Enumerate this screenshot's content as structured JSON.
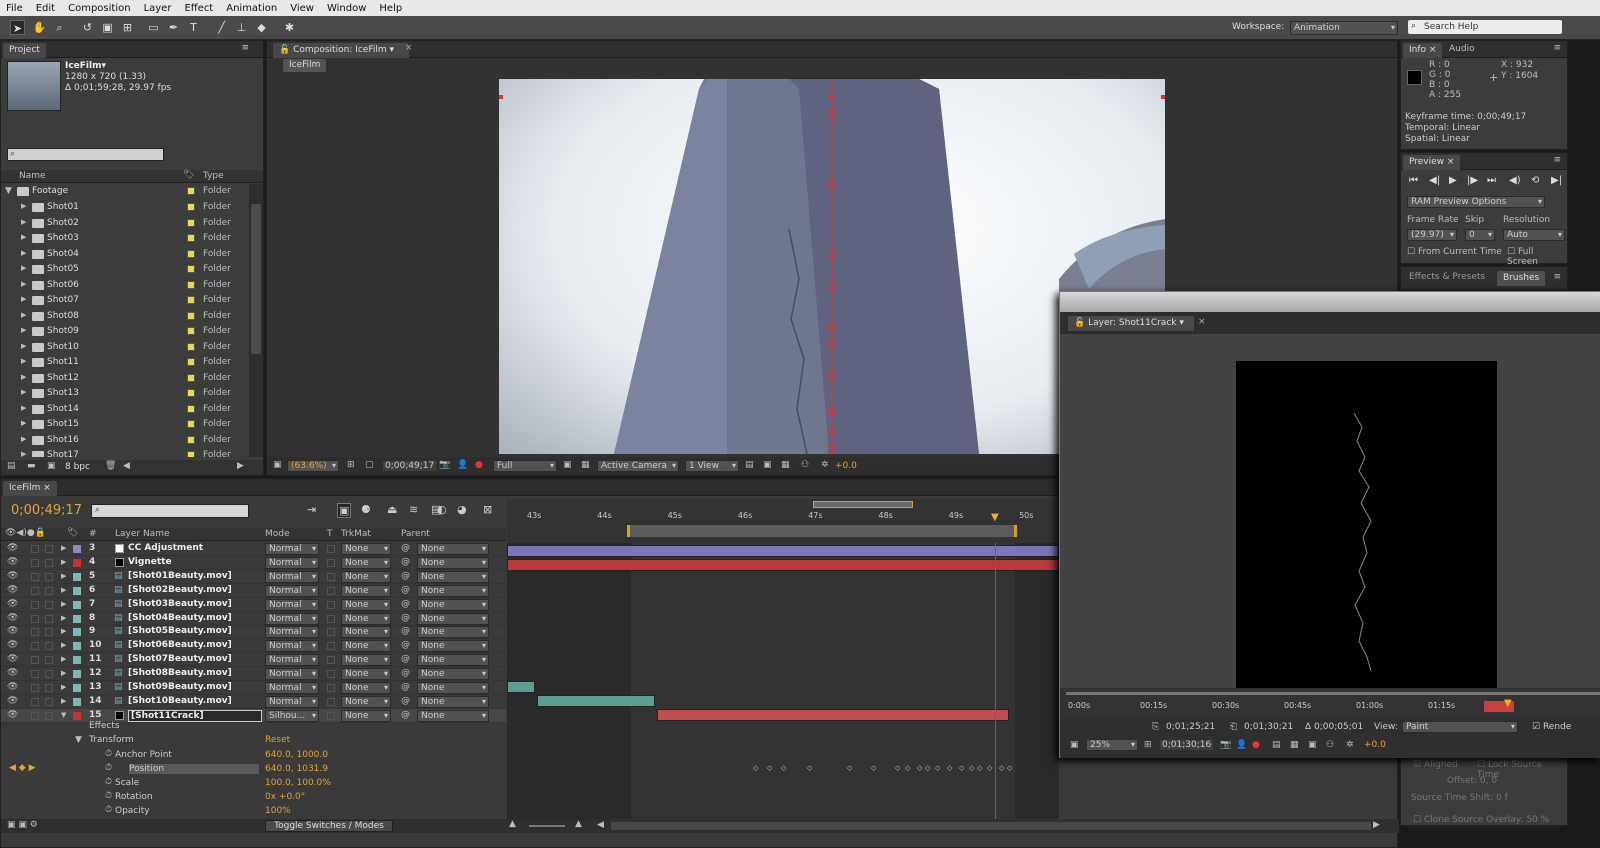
{
  "menu": [
    "File",
    "Edit",
    "Composition",
    "Layer",
    "Effect",
    "Animation",
    "View",
    "Window",
    "Help"
  ],
  "workspace": {
    "label": "Workspace:",
    "value": "Animation"
  },
  "search_help": "Search Help",
  "project": {
    "tab": "Project",
    "item_name": "IceFilm▾",
    "item_size": "1280 x 720 (1.33)",
    "item_dur": "Δ 0;01;59;28, 29.97 fps",
    "col_name": "Name",
    "col_type": "Type",
    "footage": "Footage",
    "type_label": "Folder",
    "shots": [
      "Shot01",
      "Shot02",
      "Shot03",
      "Shot04",
      "Shot05",
      "Shot06",
      "Shot07",
      "Shot08",
      "Shot09",
      "Shot10",
      "Shot11",
      "Shot12",
      "Shot13",
      "Shot14",
      "Shot15",
      "Shot16",
      "Shot17"
    ],
    "bpc": "8 bpc"
  },
  "composition": {
    "tab": "Composition: IceFilm",
    "sub": "IceFilm",
    "zoom": "(63.6%)",
    "timecode": "0;00;49;17",
    "resolution": "Full",
    "camera": "Active Camera",
    "view": "1 View",
    "exposure": "+0.0"
  },
  "info": {
    "tab": "Info",
    "tab2": "Audio",
    "r": "R : 0",
    "g": "G : 0",
    "b": "B : 0",
    "a": "A : 255",
    "x": "X : 932",
    "y": "Y : 1604",
    "kf_time": "Keyframe time: 0;00;49;17",
    "temporal": "Temporal: Linear",
    "spatial": "Spatial: Linear"
  },
  "preview": {
    "tab": "Preview",
    "ram": "RAM Preview Options",
    "frame_rate_label": "Frame Rate",
    "skip_label": "Skip",
    "resolution_label": "Resolution",
    "frame_rate": "(29.97)",
    "skip": "0",
    "resolution": "Auto",
    "from_current": "From Current Time",
    "full_screen": "Full Screen"
  },
  "effects": {
    "tab": "Effects & Presets",
    "tab2": "Brushes"
  },
  "layer_panel": {
    "tab": "Layer: Shot11Crack",
    "ruler": [
      "0:00s",
      "00:15s",
      "00:30s",
      "00:45s",
      "01:00s",
      "01:15s",
      "01:"
    ],
    "t_in": "0;01;25;21",
    "t_out": "0;01;30;21",
    "t_dur": "Δ 0;00;05;01",
    "view_label": "View:",
    "view": "Paint",
    "render": "Rende",
    "zoom": "25%",
    "timecode": "0;01;30;16",
    "exposure": "+0.0"
  },
  "paint_ghost": {
    "aligned": "Aligned",
    "lock": "Lock Source Time",
    "offset": "Offset: 0, 0",
    "shift": "Source Time Shift: 0 f",
    "clone": "Clone Source Overlay: 50 %"
  },
  "timeline": {
    "tab": "IceFilm",
    "timecode": "0;00;49;17",
    "cols": {
      "num": "#",
      "name": "Layer Name",
      "mode": "Mode",
      "t": "T",
      "trkmat": "TrkMat",
      "parent": "Parent"
    },
    "ruler": [
      "43s",
      "44s",
      "45s",
      "46s",
      "47s",
      "48s",
      "49s",
      "50s"
    ],
    "layers": [
      {
        "num": "3",
        "name": "CC Adjustment",
        "color": "#8a8ac8",
        "swatch": "#ffffff",
        "mode": "Normal"
      },
      {
        "num": "4",
        "name": "Vignette",
        "color": "#c83232",
        "swatch": "#000000",
        "mode": "Normal"
      },
      {
        "num": "5",
        "name": "[Shot01Beauty.mov]",
        "color": "#7ab8b8",
        "mode": "Normal"
      },
      {
        "num": "6",
        "name": "[Shot02Beauty.mov]",
        "color": "#7ab8b8",
        "mode": "Normal"
      },
      {
        "num": "7",
        "name": "[Shot03Beauty.mov]",
        "color": "#7ab8b8",
        "mode": "Normal"
      },
      {
        "num": "8",
        "name": "[Shot04Beauty.mov]",
        "color": "#7ab8b8",
        "mode": "Normal"
      },
      {
        "num": "9",
        "name": "[Shot05Beauty.mov]",
        "color": "#7ab8b8",
        "mode": "Normal"
      },
      {
        "num": "10",
        "name": "[Shot06Beauty.mov]",
        "color": "#7ab8b8",
        "mode": "Normal"
      },
      {
        "num": "11",
        "name": "[Shot07Beauty.mov]",
        "color": "#7ab8b8",
        "mode": "Normal"
      },
      {
        "num": "12",
        "name": "[Shot08Beauty.mov]",
        "color": "#7ab8b8",
        "mode": "Normal"
      },
      {
        "num": "13",
        "name": "[Shot09Beauty.mov]",
        "color": "#7ab8b8",
        "mode": "Normal"
      },
      {
        "num": "14",
        "name": "[Shot10Beauty.mov]",
        "color": "#7ab8b8",
        "mode": "Normal"
      },
      {
        "num": "15",
        "name": "[Shot11Crack]",
        "color": "#c83232",
        "swatch": "#000000",
        "mode": "Silhou..."
      }
    ],
    "trkmat": "None",
    "parent": "None",
    "effects": "Effects",
    "transform": "Transform",
    "reset": "Reset",
    "props": [
      {
        "name": "Anchor Point",
        "value": "640.0, 1000.0"
      },
      {
        "name": "Position",
        "value": "640.0, 1031.9"
      },
      {
        "name": "Scale",
        "value": "100.0, 100.0%"
      },
      {
        "name": "Rotation",
        "value": "0x +0.0°"
      },
      {
        "name": "Opacity",
        "value": "100%"
      }
    ],
    "toggle": "Toggle Switches / Modes"
  }
}
